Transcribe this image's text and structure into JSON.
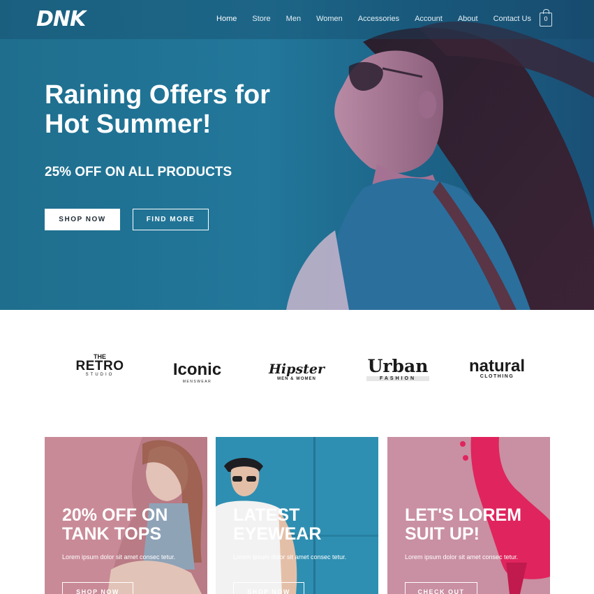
{
  "header": {
    "logo": "DNK",
    "nav": [
      "Home",
      "Store",
      "Men",
      "Women",
      "Accessories",
      "Account",
      "About",
      "Contact Us"
    ],
    "cart_count": "0"
  },
  "hero": {
    "title": "Raining Offers for Hot Summer!",
    "subtitle": "25% OFF ON ALL PRODUCTS",
    "primary_button": "SHOP NOW",
    "secondary_button": "FIND MORE"
  },
  "brands": {
    "retro": {
      "small": "THE",
      "big": "RETRO",
      "tiny": "STUDIO"
    },
    "iconic": {
      "big": "Iconic",
      "tiny": "MENSWEAR"
    },
    "hipster": {
      "big": "Hipster",
      "tiny": "MEN & WOMEN"
    },
    "urban": {
      "big": "Urban",
      "tiny": "FASHION"
    },
    "natural": {
      "big": "natural",
      "tiny": "CLOTHING"
    }
  },
  "cards": [
    {
      "title": "20% OFF ON TANK TOPS",
      "text": "Lorem ipsum dolor sit amet consec tetur.",
      "button": "SHOP NOW"
    },
    {
      "title": "LATEST EYEWEAR",
      "text": "Lorem ipsum dolor sit amet consec tetur.",
      "button": "SHOP NOW"
    },
    {
      "title": "LET'S LOREM SUIT UP!",
      "text": "Lorem ipsum dolor sit amet consec tetur.",
      "button": "CHECK OUT"
    }
  ],
  "colors": {
    "hero_blue": "#22779a",
    "card_pink": "#c98a97",
    "card_blue": "#2e8fb2",
    "shoe_magenta": "#e0245e"
  }
}
